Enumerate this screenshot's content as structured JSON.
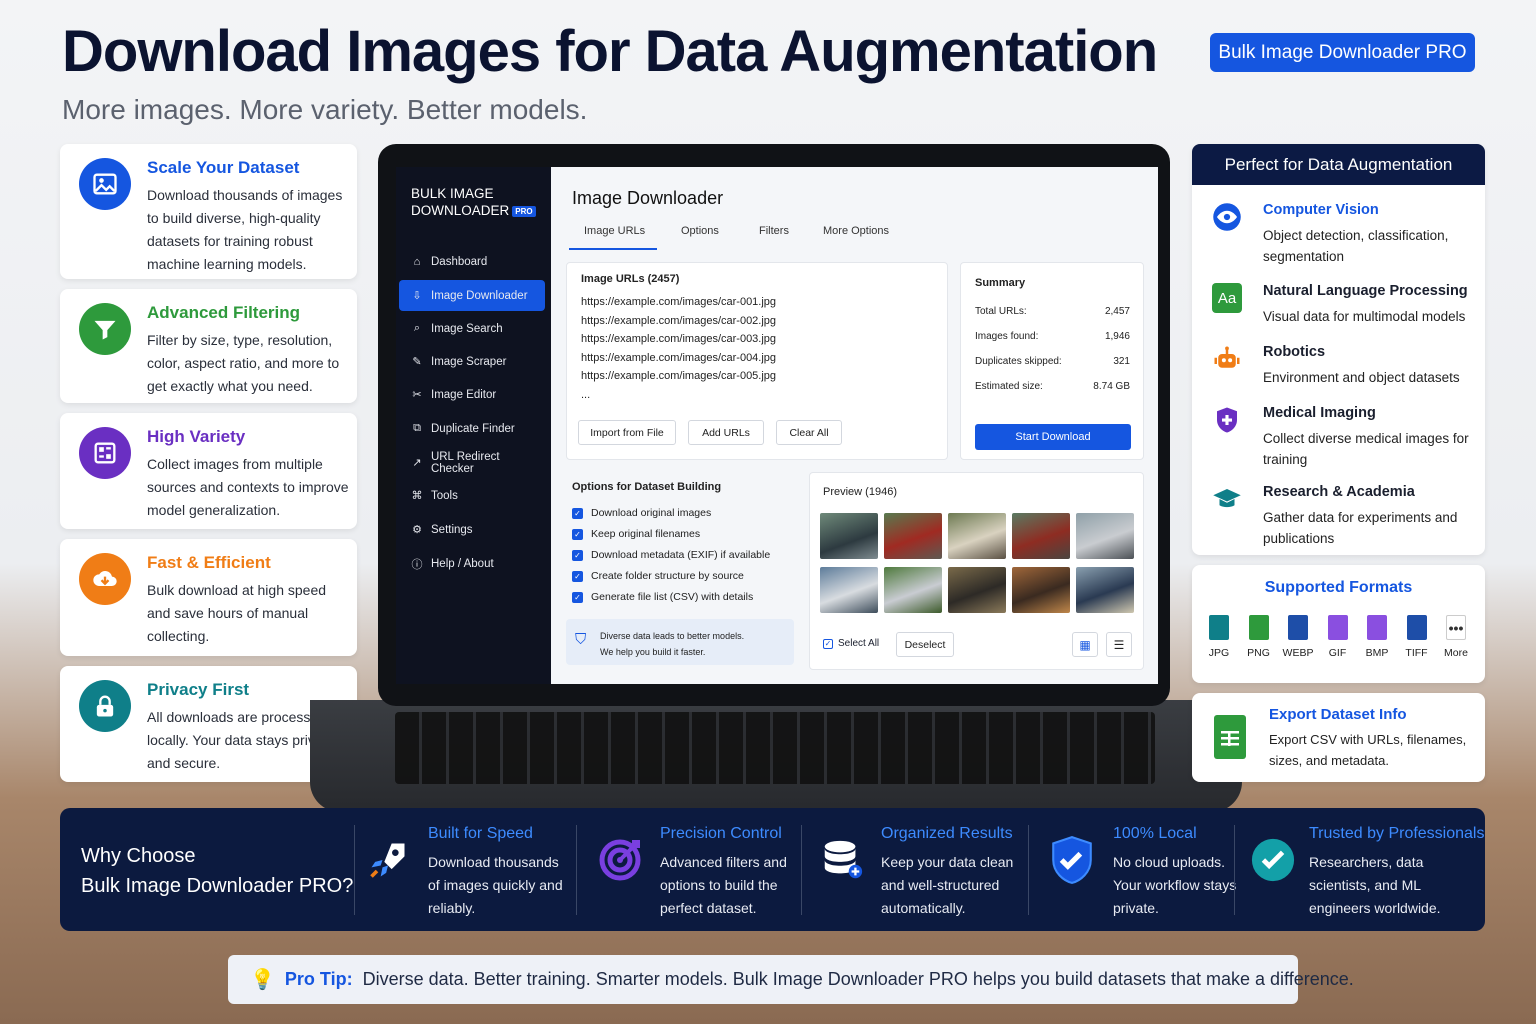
{
  "header": {
    "title": "Download Images for Data Augmentation",
    "subtitle": "More images. More variety. Better models.",
    "badge": "Bulk Image Downloader PRO"
  },
  "features": [
    {
      "title": "Scale Your Dataset",
      "desc": "Download thousands of images to build diverse, high-quality datasets for training robust machine learning models.",
      "color": "#1556e0",
      "icon": "image-icon"
    },
    {
      "title": "Advanced Filtering",
      "desc": "Filter by size, type, resolution, color, aspect ratio, and more to get exactly what you need.",
      "color": "#2e9a3c",
      "icon": "filter-icon"
    },
    {
      "title": "High Variety",
      "desc": "Collect images from multiple sources and contexts to improve model generalization.",
      "color": "#6a2fc2",
      "icon": "grid-icon"
    },
    {
      "title": "Fast & Efficient",
      "desc": "Bulk download at high speed and save hours of manual collecting.",
      "color": "#f07d16",
      "icon": "cloud-download-icon"
    },
    {
      "title": "Privacy First",
      "desc": "All downloads are processed locally. Your data stays private and secure.",
      "color": "#0f7f89",
      "icon": "lock-icon"
    }
  ],
  "app": {
    "brand_line1": "BULK IMAGE",
    "brand_line2": "DOWNLOADER",
    "brand_badge": "PRO",
    "nav": [
      {
        "label": "Dashboard",
        "icon": "home-icon",
        "glyph": "⌂"
      },
      {
        "label": "Image Downloader",
        "icon": "download-icon",
        "glyph": "⇩"
      },
      {
        "label": "Image Search",
        "icon": "search-icon",
        "glyph": "⌕"
      },
      {
        "label": "Image Scraper",
        "icon": "scraper-icon",
        "glyph": "✎"
      },
      {
        "label": "Image Editor",
        "icon": "crop-icon",
        "glyph": "✂"
      },
      {
        "label": "Duplicate Finder",
        "icon": "duplicate-icon",
        "glyph": "⧉"
      },
      {
        "label": "URL Redirect Checker",
        "icon": "redirect-icon",
        "glyph": "↗"
      },
      {
        "label": "Tools",
        "icon": "command-icon",
        "glyph": "⌘"
      },
      {
        "label": "Settings",
        "icon": "gear-icon",
        "glyph": "⚙"
      },
      {
        "label": "Help / About",
        "icon": "info-icon",
        "glyph": "ⓘ"
      }
    ],
    "page_title": "Image Downloader",
    "tabs": [
      "Image URLs",
      "Options",
      "Filters",
      "More Options"
    ],
    "urls_title": "Image URLs (2457)",
    "urls": [
      "https://example.com/images/car-001.jpg",
      "https://example.com/images/car-002.jpg",
      "https://example.com/images/car-003.jpg",
      "https://example.com/images/car-004.jpg",
      "https://example.com/images/car-005.jpg",
      "..."
    ],
    "url_buttons": [
      "Import from File",
      "Add URLs",
      "Clear All"
    ],
    "summary": {
      "title": "Summary",
      "rows": [
        {
          "label": "Total URLs:",
          "value": "2,457"
        },
        {
          "label": "Images found:",
          "value": "1,946"
        },
        {
          "label": "Duplicates skipped:",
          "value": "321"
        },
        {
          "label": "Estimated size:",
          "value": "8.74 GB"
        }
      ],
      "start": "Start Download"
    },
    "options": {
      "title": "Options for Dataset Building",
      "items": [
        "Download original images",
        "Keep original filenames",
        "Download metadata (EXIF) if available",
        "Create folder structure by source",
        "Generate file list (CSV) with details"
      ],
      "note_line1": "Diverse data leads to better models.",
      "note_line2": "We help you build it faster."
    },
    "preview": {
      "title": "Preview (1946)",
      "select_all": "Select All",
      "deselect": "Deselect"
    }
  },
  "usecases": {
    "title": "Perfect for Data Augmentation",
    "items": [
      {
        "title": "Computer Vision",
        "desc": "Object detection, classification, segmentation",
        "color": "#1556e0",
        "icon": "eye-icon"
      },
      {
        "title": "Natural Language Processing",
        "desc": "Visual data for multimodal models",
        "color": "#2e9a3c",
        "icon": "text-icon",
        "glyph": "Aa"
      },
      {
        "title": "Robotics",
        "desc": "Environment and object datasets",
        "color": "#f07d16",
        "icon": "robot-icon"
      },
      {
        "title": "Medical Imaging",
        "desc": "Collect diverse medical images for training",
        "color": "#6a2fc2",
        "icon": "medical-shield-icon"
      },
      {
        "title": "Research & Academia",
        "desc": "Gather data for experiments and publications",
        "color": "#0f7f89",
        "icon": "graduation-cap-icon"
      }
    ]
  },
  "formats": {
    "title": "Supported Formats",
    "items": [
      {
        "label": "JPG",
        "color": "#0f7f89"
      },
      {
        "label": "PNG",
        "color": "#2e9a3c"
      },
      {
        "label": "WEBP",
        "color": "#1e4ea8"
      },
      {
        "label": "GIF",
        "color": "#8a4fe0"
      },
      {
        "label": "BMP",
        "color": "#8a4fe0"
      },
      {
        "label": "TIFF",
        "color": "#1e4ea8"
      },
      {
        "label": "More",
        "color": "#ffffff"
      }
    ]
  },
  "export": {
    "title": "Export Dataset Info",
    "desc": "Export CSV with URLs, filenames, sizes, and metadata."
  },
  "why": {
    "line1": "Why Choose",
    "line2": "Bulk Image Downloader PRO?",
    "items": [
      {
        "title": "Built for Speed",
        "desc": "Download thousands of images quickly and reliably.",
        "icon": "rocket-icon"
      },
      {
        "title": "Precision Control",
        "desc": "Advanced filters and options to build the perfect dataset.",
        "icon": "target-icon"
      },
      {
        "title": "Organized Results",
        "desc": "Keep your data clean and well-structured automatically.",
        "icon": "database-icon"
      },
      {
        "title": "100% Local",
        "desc": "No cloud uploads. Your workflow stays private.",
        "icon": "shield-check-icon"
      },
      {
        "title": "Trusted by Professionals",
        "desc": "Researchers, data scientists, and ML engineers worldwide.",
        "icon": "check-circle-icon"
      }
    ]
  },
  "tip": {
    "label": "Pro Tip:",
    "text": "Diverse data. Better training. Smarter models. Bulk Image Downloader PRO helps you build datasets that make a difference."
  }
}
